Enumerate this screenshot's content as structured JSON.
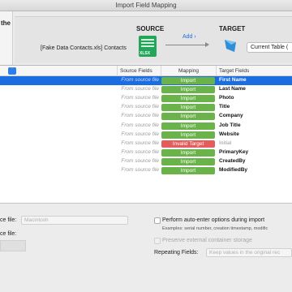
{
  "window": {
    "title": "Import Field Mapping"
  },
  "header": {
    "instruction_partial": "the",
    "source_label": "SOURCE",
    "target_label": "TARGET",
    "source_file": "[Fake Data Contacts.xls] Contacts",
    "xlsx_icon_text": "XLSX",
    "add_label": "Add ›",
    "target_select": "Current Table ("
  },
  "table": {
    "headers": {
      "source": "Source Fields",
      "mapping": "Mapping",
      "target": "Target Fields"
    },
    "rows": [
      {
        "source": "From source file",
        "mapping": "Import",
        "target": "First Name",
        "selected": true
      },
      {
        "source": "From source file",
        "mapping": "Import",
        "target": "Last Name"
      },
      {
        "source": "From source file",
        "mapping": "Import",
        "target": "Photo"
      },
      {
        "source": "From source file",
        "mapping": "Import",
        "target": "Title"
      },
      {
        "source": "From source file",
        "mapping": "Import",
        "target": "Company"
      },
      {
        "source": "From source file",
        "mapping": "Import",
        "target": "Job Title"
      },
      {
        "source": "From source file",
        "mapping": "Import",
        "target": "Website"
      },
      {
        "source": "From source file",
        "mapping": "Invalid Target",
        "target": "Initial"
      },
      {
        "source": "From source file",
        "mapping": "Import",
        "target": "PrimaryKey"
      },
      {
        "source": "From source file",
        "mapping": "Import",
        "target": "CreatedBy"
      },
      {
        "source": "From source file",
        "mapping": "Import",
        "target": "ModifiedBy"
      }
    ]
  },
  "footer": {
    "source_file_label": "ce file:",
    "source_file_value": "Macintosh",
    "ce_file_label": "ce file:",
    "auto_enter_label": "Perform auto-enter options during import",
    "auto_enter_examples": "Examples: serial number, creation timestamp, modific",
    "preserve_label": "Preserve external container storage",
    "repeating_label": "Repeating Fields:",
    "repeating_value": "Keep values in the original rec"
  },
  "colors": {
    "accent": "#1c6ddf",
    "import": "#6ab34a",
    "invalid": "#e35d5d"
  }
}
